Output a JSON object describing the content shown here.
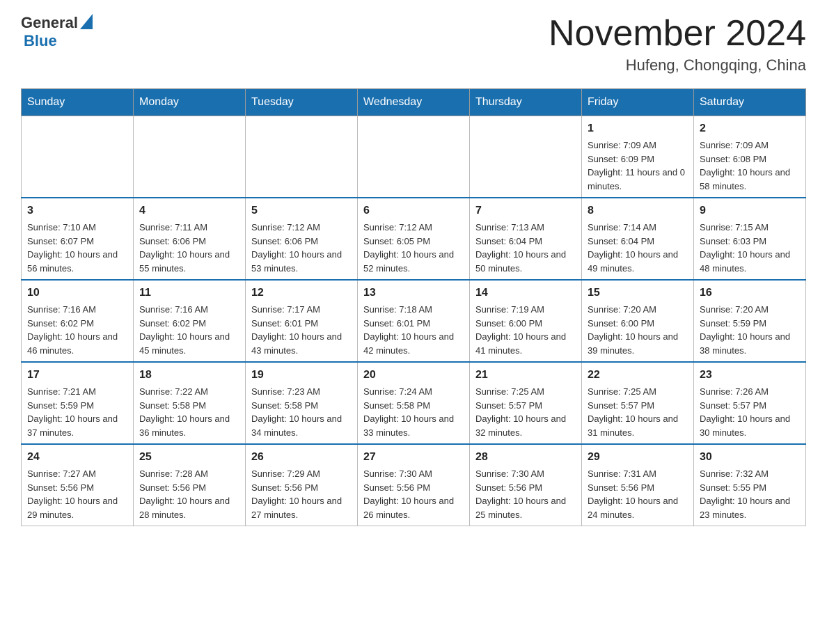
{
  "header": {
    "logo_general": "General",
    "logo_blue": "Blue",
    "month_title": "November 2024",
    "location": "Hufeng, Chongqing, China"
  },
  "weekdays": [
    "Sunday",
    "Monday",
    "Tuesday",
    "Wednesday",
    "Thursday",
    "Friday",
    "Saturday"
  ],
  "weeks": [
    [
      {
        "day": "",
        "info": ""
      },
      {
        "day": "",
        "info": ""
      },
      {
        "day": "",
        "info": ""
      },
      {
        "day": "",
        "info": ""
      },
      {
        "day": "",
        "info": ""
      },
      {
        "day": "1",
        "info": "Sunrise: 7:09 AM\nSunset: 6:09 PM\nDaylight: 11 hours and 0 minutes."
      },
      {
        "day": "2",
        "info": "Sunrise: 7:09 AM\nSunset: 6:08 PM\nDaylight: 10 hours and 58 minutes."
      }
    ],
    [
      {
        "day": "3",
        "info": "Sunrise: 7:10 AM\nSunset: 6:07 PM\nDaylight: 10 hours and 56 minutes."
      },
      {
        "day": "4",
        "info": "Sunrise: 7:11 AM\nSunset: 6:06 PM\nDaylight: 10 hours and 55 minutes."
      },
      {
        "day": "5",
        "info": "Sunrise: 7:12 AM\nSunset: 6:06 PM\nDaylight: 10 hours and 53 minutes."
      },
      {
        "day": "6",
        "info": "Sunrise: 7:12 AM\nSunset: 6:05 PM\nDaylight: 10 hours and 52 minutes."
      },
      {
        "day": "7",
        "info": "Sunrise: 7:13 AM\nSunset: 6:04 PM\nDaylight: 10 hours and 50 minutes."
      },
      {
        "day": "8",
        "info": "Sunrise: 7:14 AM\nSunset: 6:04 PM\nDaylight: 10 hours and 49 minutes."
      },
      {
        "day": "9",
        "info": "Sunrise: 7:15 AM\nSunset: 6:03 PM\nDaylight: 10 hours and 48 minutes."
      }
    ],
    [
      {
        "day": "10",
        "info": "Sunrise: 7:16 AM\nSunset: 6:02 PM\nDaylight: 10 hours and 46 minutes."
      },
      {
        "day": "11",
        "info": "Sunrise: 7:16 AM\nSunset: 6:02 PM\nDaylight: 10 hours and 45 minutes."
      },
      {
        "day": "12",
        "info": "Sunrise: 7:17 AM\nSunset: 6:01 PM\nDaylight: 10 hours and 43 minutes."
      },
      {
        "day": "13",
        "info": "Sunrise: 7:18 AM\nSunset: 6:01 PM\nDaylight: 10 hours and 42 minutes."
      },
      {
        "day": "14",
        "info": "Sunrise: 7:19 AM\nSunset: 6:00 PM\nDaylight: 10 hours and 41 minutes."
      },
      {
        "day": "15",
        "info": "Sunrise: 7:20 AM\nSunset: 6:00 PM\nDaylight: 10 hours and 39 minutes."
      },
      {
        "day": "16",
        "info": "Sunrise: 7:20 AM\nSunset: 5:59 PM\nDaylight: 10 hours and 38 minutes."
      }
    ],
    [
      {
        "day": "17",
        "info": "Sunrise: 7:21 AM\nSunset: 5:59 PM\nDaylight: 10 hours and 37 minutes."
      },
      {
        "day": "18",
        "info": "Sunrise: 7:22 AM\nSunset: 5:58 PM\nDaylight: 10 hours and 36 minutes."
      },
      {
        "day": "19",
        "info": "Sunrise: 7:23 AM\nSunset: 5:58 PM\nDaylight: 10 hours and 34 minutes."
      },
      {
        "day": "20",
        "info": "Sunrise: 7:24 AM\nSunset: 5:58 PM\nDaylight: 10 hours and 33 minutes."
      },
      {
        "day": "21",
        "info": "Sunrise: 7:25 AM\nSunset: 5:57 PM\nDaylight: 10 hours and 32 minutes."
      },
      {
        "day": "22",
        "info": "Sunrise: 7:25 AM\nSunset: 5:57 PM\nDaylight: 10 hours and 31 minutes."
      },
      {
        "day": "23",
        "info": "Sunrise: 7:26 AM\nSunset: 5:57 PM\nDaylight: 10 hours and 30 minutes."
      }
    ],
    [
      {
        "day": "24",
        "info": "Sunrise: 7:27 AM\nSunset: 5:56 PM\nDaylight: 10 hours and 29 minutes."
      },
      {
        "day": "25",
        "info": "Sunrise: 7:28 AM\nSunset: 5:56 PM\nDaylight: 10 hours and 28 minutes."
      },
      {
        "day": "26",
        "info": "Sunrise: 7:29 AM\nSunset: 5:56 PM\nDaylight: 10 hours and 27 minutes."
      },
      {
        "day": "27",
        "info": "Sunrise: 7:30 AM\nSunset: 5:56 PM\nDaylight: 10 hours and 26 minutes."
      },
      {
        "day": "28",
        "info": "Sunrise: 7:30 AM\nSunset: 5:56 PM\nDaylight: 10 hours and 25 minutes."
      },
      {
        "day": "29",
        "info": "Sunrise: 7:31 AM\nSunset: 5:56 PM\nDaylight: 10 hours and 24 minutes."
      },
      {
        "day": "30",
        "info": "Sunrise: 7:32 AM\nSunset: 5:55 PM\nDaylight: 10 hours and 23 minutes."
      }
    ]
  ]
}
